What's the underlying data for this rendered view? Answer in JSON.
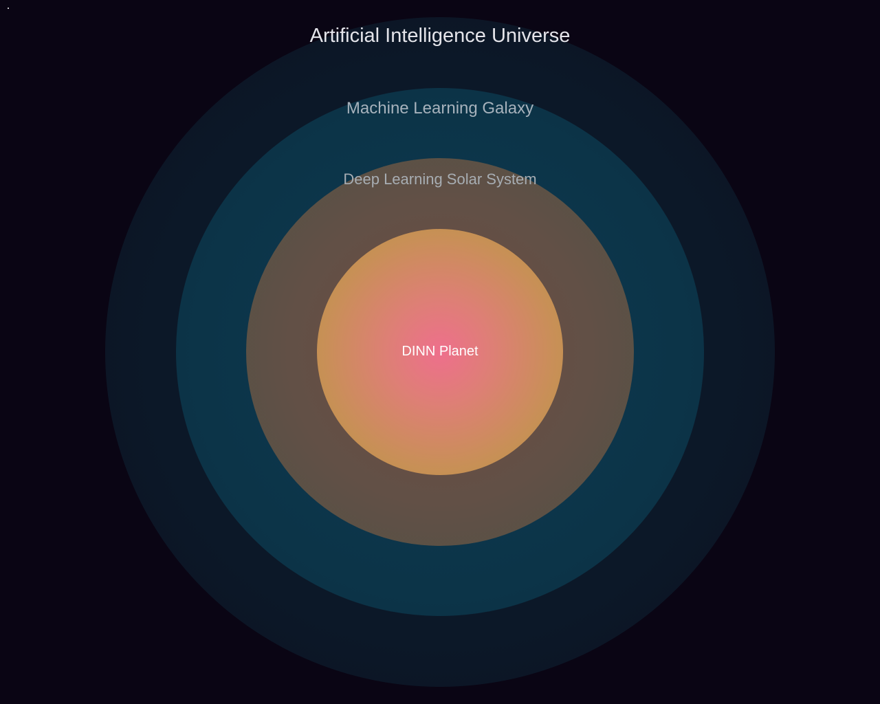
{
  "diagram": {
    "layers": [
      {
        "id": "universe",
        "label": "Artificial Intelligence Universe"
      },
      {
        "id": "galaxy",
        "label": "Machine Learning Galaxy"
      },
      {
        "id": "solar_system",
        "label": "Deep Learning Solar System"
      },
      {
        "id": "planet",
        "label": "DINN Planet"
      }
    ]
  },
  "colors": {
    "background": "#0a0514",
    "universe": "#0c1828",
    "galaxy": "#0c3448",
    "solar_system": "#625046",
    "planet_center": "#ee6f8c",
    "planet_edge": "#b5963f"
  }
}
